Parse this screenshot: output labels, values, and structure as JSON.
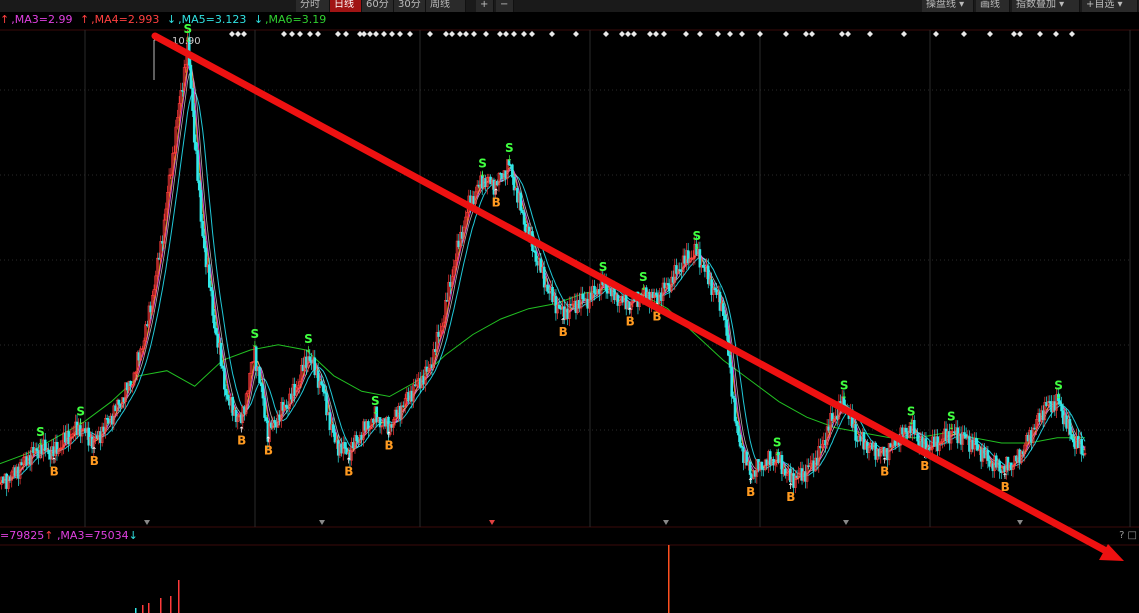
{
  "toolbar": {
    "left_tabs": [
      "分时",
      "日线",
      "60分",
      "30分",
      "周线"
    ],
    "active_tab": "日线",
    "right_tools": [
      "操盘线 ▾",
      "画线",
      "指数叠加 ▾",
      "+自选 ▾"
    ]
  },
  "ma_legend": [
    {
      "label": ",MA3=2.99",
      "arrow": "↑",
      "color": "#e040e0"
    },
    {
      "label": ",MA4=2.993",
      "arrow": "↑",
      "color": "#ff4040"
    },
    {
      "label": ",MA5=3.123",
      "arrow": "↓",
      "color": "#30e0e0"
    },
    {
      "label": ",MA6=3.19",
      "arrow": "↓",
      "color": "#30d030"
    }
  ],
  "vol_legend": [
    {
      "label": "=79825",
      "arrow": "↑",
      "color": "#e040e0"
    },
    {
      "label": ",MA3=75034",
      "arrow": "↓",
      "color": "#30e0e0"
    }
  ],
  "corner_text": "? □",
  "chart_data": {
    "type": "line",
    "peak_label": "10.90",
    "buy_marker": "B",
    "sell_marker": "S",
    "price_series": [
      2.4,
      2.6,
      2.9,
      3.1,
      3.0,
      3.3,
      3.5,
      3.2,
      3.6,
      4.0,
      4.5,
      5.5,
      7.0,
      9.0,
      10.9,
      7.5,
      5.5,
      4.0,
      3.6,
      5.0,
      3.4,
      3.8,
      4.2,
      4.9,
      4.3,
      3.2,
      3.0,
      3.4,
      3.7,
      3.5,
      3.9,
      4.3,
      4.6,
      5.5,
      6.8,
      7.8,
      8.3,
      8.2,
      8.6,
      7.6,
      6.8,
      6.1,
      5.7,
      5.9,
      6.0,
      6.3,
      6.0,
      5.9,
      6.1,
      6.0,
      6.3,
      6.7,
      6.9,
      6.3,
      5.8,
      3.4,
      2.6,
      2.8,
      2.9,
      2.5,
      2.6,
      2.9,
      3.6,
      4.0,
      3.3,
      3.1,
      3.0,
      3.3,
      3.5,
      3.1,
      3.2,
      3.4,
      3.3,
      3.1,
      2.8,
      2.7,
      2.9,
      3.4,
      3.9,
      4.0,
      3.3,
      3.0
    ],
    "ma_long_series": [
      2.8,
      3.0,
      3.3,
      3.6,
      4.0,
      4.5,
      4.6,
      4.3,
      4.8,
      5.0,
      5.1,
      5.0,
      4.5,
      4.2,
      4.1,
      4.4,
      4.9,
      5.3,
      5.6,
      5.8,
      5.9,
      6.1,
      6.2,
      6.1,
      5.8,
      5.3,
      4.8,
      4.4,
      4.0,
      3.7,
      3.5,
      3.4,
      3.3,
      3.3,
      3.4,
      3.3,
      3.2,
      3.2,
      3.3,
      3.3
    ]
  }
}
